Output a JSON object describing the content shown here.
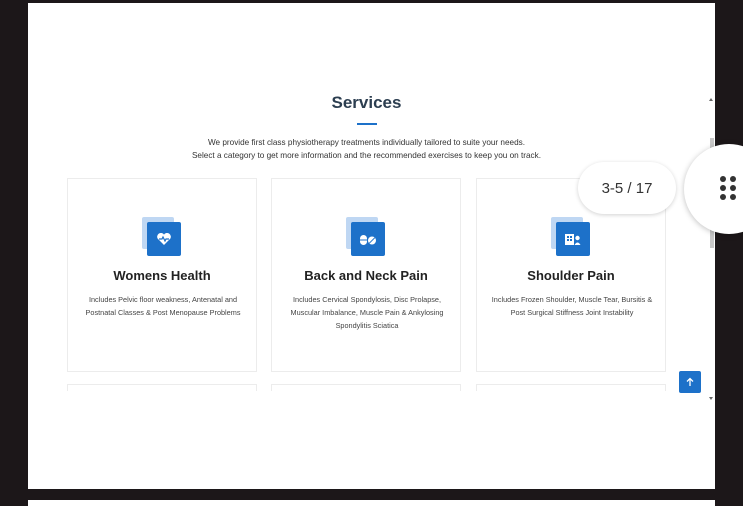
{
  "section": {
    "title": "Services",
    "intro_line1": "We provide first class physiotherapy treatments individually tailored to suite your needs.",
    "intro_line2": "Select a category to get more information and the recommended exercises to keep you on track."
  },
  "cards": [
    {
      "title": "Womens Health",
      "description": "Includes Pelvic floor weakness, Antenatal and Postnatal Classes & Post Menopause Problems",
      "icon": "heart-pulse-icon"
    },
    {
      "title": "Back and Neck Pain",
      "description": "Includes Cervical Spondylosis, Disc Prolapse, Muscular Imbalance, Muscle Pain & Ankylosing Spondylitis Sciatica",
      "icon": "pills-icon"
    },
    {
      "title": "Shoulder Pain",
      "description": "Includes Frozen Shoulder, Muscle Tear, Bursitis & Post Surgical Stiffness Joint Instability",
      "icon": "hospital-user-icon"
    }
  ],
  "viewer": {
    "page_counter": "3-5 / 17"
  },
  "colors": {
    "accent": "#1d71c9",
    "background": "#1c1719"
  }
}
